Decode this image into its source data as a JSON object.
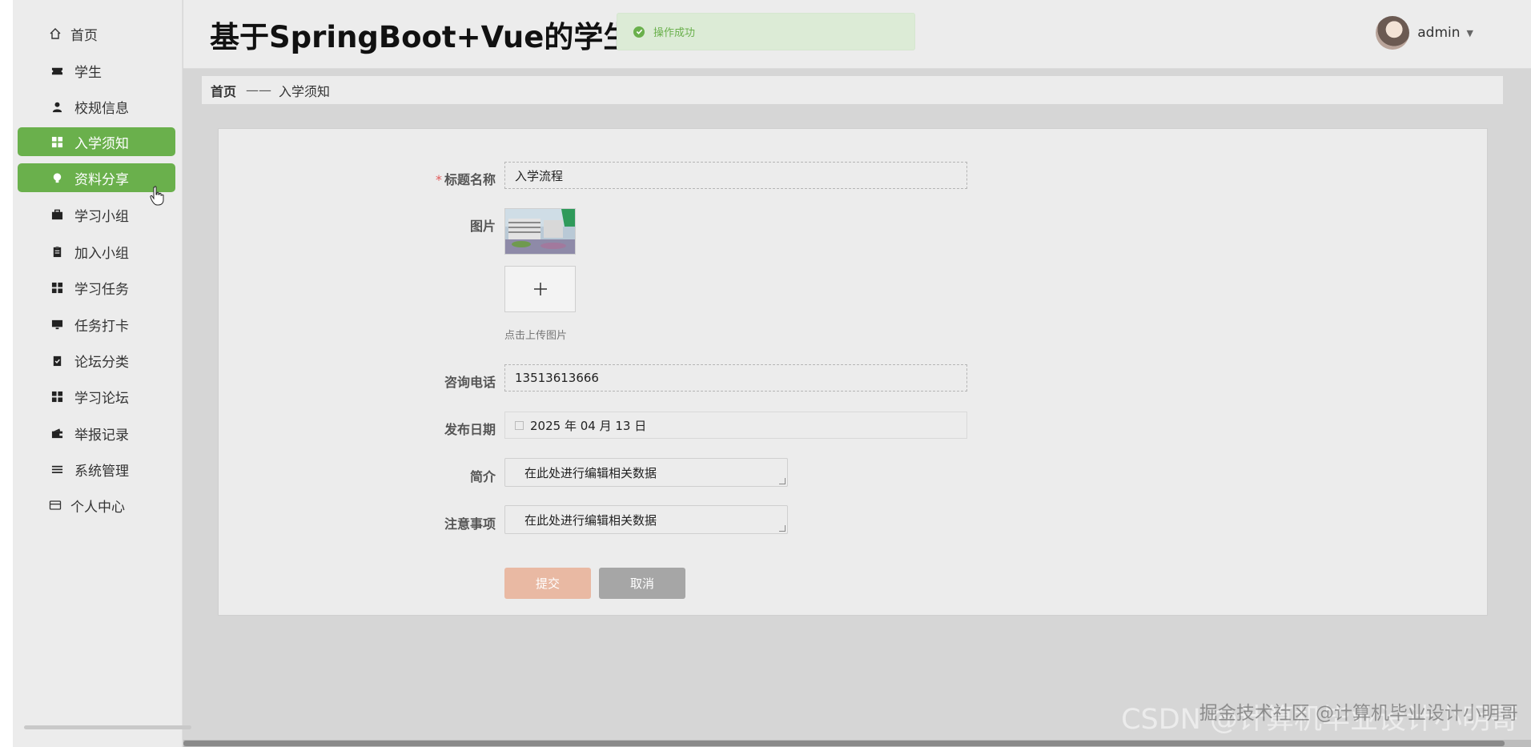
{
  "header": {
    "title": "基于SpringBoot+Vue的学生交",
    "toast": "操作成功",
    "username": "admin"
  },
  "sidebar": {
    "items": [
      {
        "label": "首页",
        "icon": "home-icon"
      },
      {
        "label": "学生",
        "icon": "ticket-icon"
      },
      {
        "label": "校规信息",
        "icon": "user-icon"
      },
      {
        "label": "入学须知",
        "icon": "grid-icon",
        "active": true
      },
      {
        "label": "资料分享",
        "icon": "bulb-icon",
        "active": true
      },
      {
        "label": "学习小组",
        "icon": "briefcase-icon"
      },
      {
        "label": "加入小组",
        "icon": "clipboard-icon"
      },
      {
        "label": "学习任务",
        "icon": "grid-icon"
      },
      {
        "label": "任务打卡",
        "icon": "monitor-icon"
      },
      {
        "label": "论坛分类",
        "icon": "check-clipboard-icon"
      },
      {
        "label": "学习论坛",
        "icon": "grid-icon"
      },
      {
        "label": "举报记录",
        "icon": "wallet-icon"
      },
      {
        "label": "系统管理",
        "icon": "list-icon"
      },
      {
        "label": "个人中心",
        "icon": "card-icon"
      }
    ]
  },
  "breadcrumb": {
    "home": "首页",
    "separator": "——",
    "current": "入学须知"
  },
  "form": {
    "required_mark": "*",
    "title_label": "标题名称",
    "title_value": "入学流程",
    "image_label": "图片",
    "upload_hint": "点击上传图片",
    "phone_label": "咨询电话",
    "phone_value": "13513613666",
    "date_label": "发布日期",
    "date_value": "2025 年 04 月 13 日",
    "intro_label": "简介",
    "intro_value": "在此处进行编辑相关数据",
    "notes_label": "注意事项",
    "notes_value": "在此处进行编辑相关数据",
    "submit_label": "提交",
    "cancel_label": "取消"
  },
  "watermark": {
    "line1": "掘金技术社区 @计算机毕业设计小明哥",
    "line2": "CSDN @计算机毕业设计小明哥"
  },
  "colors": {
    "accent": "#6ab04c",
    "submit": "#e9b9a3",
    "cancel": "#a6a6a6"
  }
}
